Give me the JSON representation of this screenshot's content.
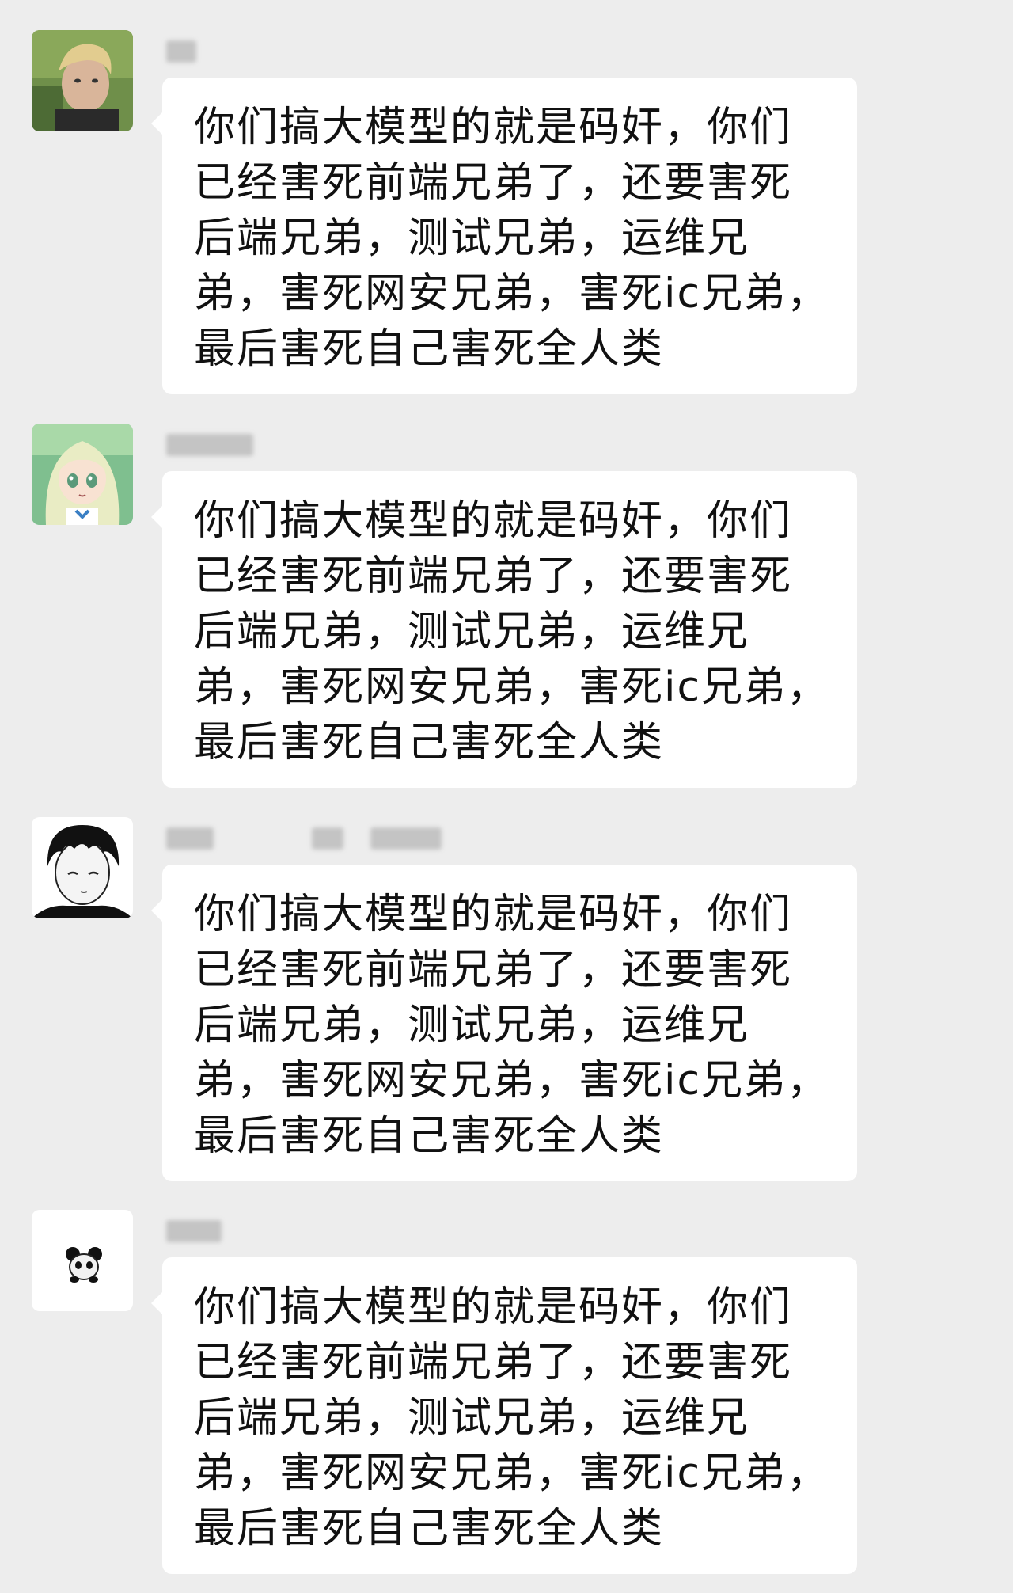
{
  "conversation": {
    "messages": [
      {
        "avatar_icon": "blond-man-photo-avatar-icon",
        "text": "你们搞大模型的就是码奸，你们已经害死前端兄弟了，还要害死后端兄弟，测试兄弟，运维兄弟，害死网安兄弟，害死ic兄弟，最后害死自己害死全人类"
      },
      {
        "avatar_icon": "anime-girl-avatar-icon",
        "text": "你们搞大模型的就是码奸，你们已经害死前端兄弟了，还要害死后端兄弟，测试兄弟，运维兄弟，害死网安兄弟，害死ic兄弟，最后害死自己害死全人类"
      },
      {
        "avatar_icon": "anime-boy-avatar-icon",
        "text": "你们搞大模型的就是码奸，你们已经害死前端兄弟了，还要害死后端兄弟，测试兄弟，运维兄弟，害死网安兄弟，害死ic兄弟，最后害死自己害死全人类"
      },
      {
        "avatar_icon": "panda-avatar-icon",
        "text": "你们搞大模型的就是码奸，你们已经害死前端兄弟了，还要害死后端兄弟，测试兄弟，运维兄弟，害死网安兄弟，害死ic兄弟，最后害死自己害死全人类"
      }
    ]
  },
  "colors": {
    "background": "#ededed",
    "bubble": "#ffffff",
    "text": "#111111"
  }
}
